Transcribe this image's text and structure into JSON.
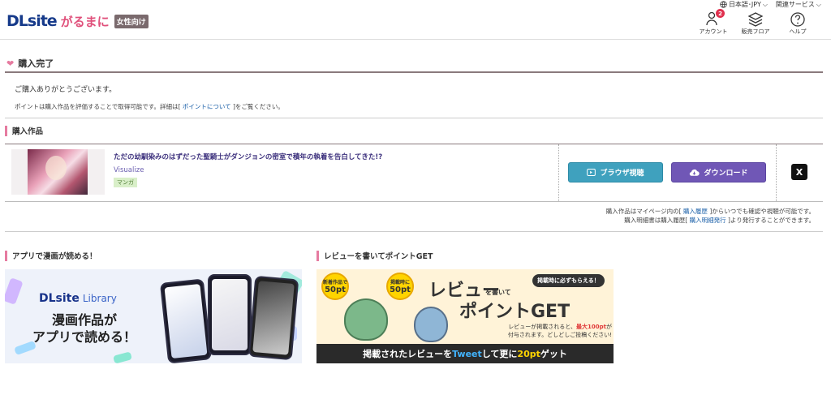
{
  "header": {
    "logo_main": "DLsite",
    "logo_sub": "がるまに",
    "logo_badge": "女性向け",
    "top_links": [
      "日本語･JPY",
      "関連サービス"
    ],
    "icons": [
      {
        "label": "アカウント",
        "icon": "account-icon",
        "badge": "2"
      },
      {
        "label": "販売フロア",
        "icon": "floor-icon"
      },
      {
        "label": "ヘルプ",
        "icon": "help-icon"
      }
    ]
  },
  "complete": {
    "title": "購入完了",
    "thanks": "ご購入ありがとうございます。",
    "points_prefix": "ポイントは購入作品を評価することで取得可能です。詳細は[ ",
    "points_link": "ポイントについて",
    "points_suffix": " ]をご覧ください。"
  },
  "works": {
    "heading": "購入作品",
    "items": [
      {
        "title": "ただの幼馴染みのはずだった聖騎士がダンジョンの密室で積年の執着を告白してきた!?",
        "maker": "Visualize",
        "genre": "マンガ",
        "browser_label": "ブラウザ視聴",
        "download_label": "ダウンロード",
        "share_label": "X"
      }
    ],
    "history_line1_prefix": "購入作品はマイページ内の[ ",
    "history_link1": "購入履歴",
    "history_line1_suffix": " ]からいつでも確認や視聴が可能です。",
    "history_line2_prefix": "購入明細書は購入履歴[ ",
    "history_link2": "購入明細発行",
    "history_line2_suffix": " ]より発行することができます。"
  },
  "app_banner": {
    "heading": "アプリで漫画が読める！",
    "logo_text": "DLsite",
    "logo_lib": "Library",
    "line1": "漫画作品が",
    "line2": "アプリで読める！"
  },
  "review_banner": {
    "heading": "レビューを書いてポイントGET",
    "pill": "掲載時に必ずもらえる！",
    "title1": "レビュー",
    "small": "を書いて",
    "title2": "ポイントGET",
    "circle1_small": "新着作品で",
    "circle1_big": "50pt",
    "circle2_small": "掲載時に",
    "circle2_big": "50pt",
    "desc1": "レビューが掲載されると、",
    "desc_strong": "最大100pt",
    "desc2": "が",
    "desc3": "付与されます。どしどしご投稿ください!",
    "bottom_prefix": "掲載されたレビューを",
    "bottom_tweet": "Tweet",
    "bottom_mid": "して更に",
    "bottom_pt": "20pt",
    "bottom_suffix": "ゲット"
  }
}
